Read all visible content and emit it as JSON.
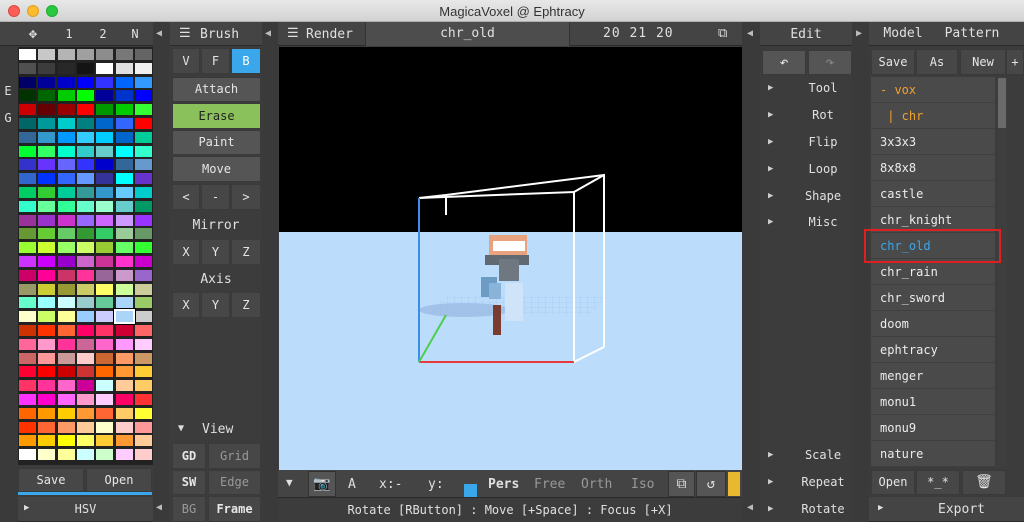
{
  "window": {
    "title": "MagicaVoxel @ Ephtracy"
  },
  "palette_panel": {
    "tabs": [
      "1",
      "2",
      "N"
    ],
    "side_letters": [
      "E",
      "G"
    ],
    "save_label": "Save",
    "open_label": "Open",
    "hsv_label": "HSV",
    "selected_color": "#aad4f8"
  },
  "brush_panel": {
    "title": "Brush",
    "modes": [
      "V",
      "F",
      "B"
    ],
    "actions": [
      "Attach",
      "Erase",
      "Paint",
      "Move"
    ],
    "nav": [
      "<",
      "-",
      ">"
    ],
    "mirror_label": "Mirror",
    "mirror_axes": [
      "X",
      "Y",
      "Z"
    ],
    "axis_label": "Axis",
    "axis_axes": [
      "X",
      "Y",
      "Z"
    ],
    "view_label": "View",
    "view_buttons": [
      [
        "GD",
        "Grid"
      ],
      [
        "SW",
        "Edge"
      ],
      [
        "BG",
        "Frame"
      ]
    ]
  },
  "render_panel": {
    "title": "Render",
    "file_name": "chr_old",
    "dimensions": "20 21 20",
    "bottom": {
      "a_label": "A",
      "x_label": "x:-",
      "y_label": "y:",
      "views": [
        "Pers",
        "Free",
        "Orth",
        "Iso"
      ]
    },
    "status_text": "Rotate [RButton] : Move [+Space] : Focus [+X]"
  },
  "edit_panel": {
    "title": "Edit",
    "items": [
      "Tool",
      "Rot",
      "Flip",
      "Loop",
      "Shape",
      "Misc"
    ],
    "bottom_items": [
      "Scale",
      "Repeat",
      "Rotate"
    ]
  },
  "model_panel": {
    "tabs": [
      "Model",
      "Pattern"
    ],
    "actions": [
      "Save",
      "As",
      "New",
      "+"
    ],
    "files": [
      {
        "name": "- vox",
        "kind": "folder"
      },
      {
        "name": " | chr",
        "kind": "folder"
      },
      {
        "name": "3x3x3",
        "kind": "file"
      },
      {
        "name": "8x8x8",
        "kind": "file"
      },
      {
        "name": "castle",
        "kind": "file"
      },
      {
        "name": "chr_knight",
        "kind": "file"
      },
      {
        "name": "chr_old",
        "kind": "selected"
      },
      {
        "name": "chr_rain",
        "kind": "file"
      },
      {
        "name": "chr_sword",
        "kind": "file"
      },
      {
        "name": "doom",
        "kind": "file"
      },
      {
        "name": "ephtracy",
        "kind": "file"
      },
      {
        "name": "menger",
        "kind": "file"
      },
      {
        "name": "monu1",
        "kind": "file"
      },
      {
        "name": "monu9",
        "kind": "file"
      },
      {
        "name": "nature",
        "kind": "file"
      }
    ],
    "open_label": "Open",
    "star_label": "*_*",
    "export_label": "Export"
  },
  "colors": {
    "accent_green": "#8bc15a",
    "accent_blue": "#3aa7ea",
    "folder_text": "#f0a030",
    "selected_text": "#3aa7ea",
    "highlight_box": "#e02020",
    "sky": "#bcdcfc"
  }
}
